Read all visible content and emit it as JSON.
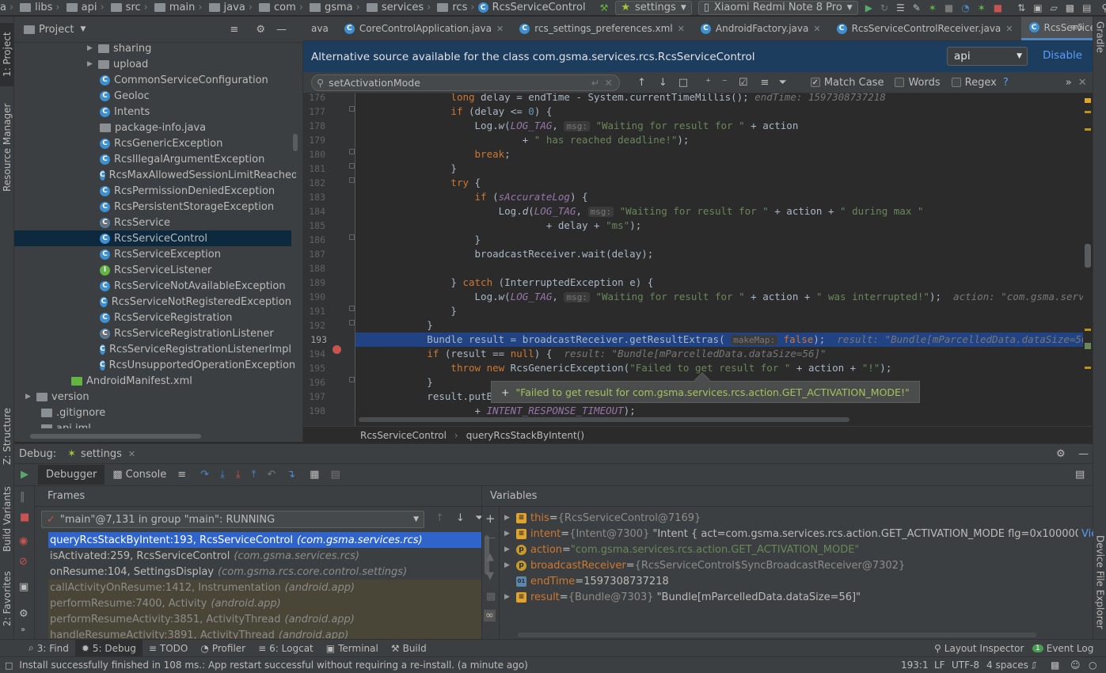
{
  "navbar": {
    "breadcrumbs": [
      "a",
      "libs",
      "api",
      "src",
      "main",
      "java",
      "com",
      "gsma",
      "services",
      "rcs"
    ],
    "current_class": "RcsServiceControl",
    "run_config": "settings",
    "device": "Xiaomi Redmi Note 8 Pro"
  },
  "left_tabs": {
    "project": "1: Project",
    "resource_manager": "Resource Manager",
    "structure": "Z: Structure",
    "build_variants": "Build Variants",
    "favorites": "2: Favorites"
  },
  "right_tabs": {
    "gradle": "Gradle",
    "device_file_explorer": "Device File Explorer"
  },
  "project": {
    "title": "Project",
    "tree": [
      {
        "label": "sharing",
        "kind": "folder",
        "expanded": false
      },
      {
        "label": "upload",
        "kind": "folder",
        "expanded": false
      },
      {
        "label": "CommonServiceConfiguration",
        "kind": "class"
      },
      {
        "label": "Geoloc",
        "kind": "class"
      },
      {
        "label": "Intents",
        "kind": "class"
      },
      {
        "label": "package-info.java",
        "kind": "file"
      },
      {
        "label": "RcsGenericException",
        "kind": "class"
      },
      {
        "label": "RcsIllegalArgumentException",
        "kind": "class"
      },
      {
        "label": "RcsMaxAllowedSessionLimitReached",
        "kind": "class"
      },
      {
        "label": "RcsPermissionDeniedException",
        "kind": "class"
      },
      {
        "label": "RcsPersistentStorageException",
        "kind": "class"
      },
      {
        "label": "RcsService",
        "kind": "abstract"
      },
      {
        "label": "RcsServiceControl",
        "kind": "class",
        "selected": true
      },
      {
        "label": "RcsServiceException",
        "kind": "class"
      },
      {
        "label": "RcsServiceListener",
        "kind": "interface"
      },
      {
        "label": "RcsServiceNotAvailableException",
        "kind": "class"
      },
      {
        "label": "RcsServiceNotRegisteredException",
        "kind": "class"
      },
      {
        "label": "RcsServiceRegistration",
        "kind": "class"
      },
      {
        "label": "RcsServiceRegistrationListener",
        "kind": "abstract"
      },
      {
        "label": "RcsServiceRegistrationListenerImpl",
        "kind": "class"
      },
      {
        "label": "RcsUnsupportedOperationException",
        "kind": "class"
      },
      {
        "label": "AndroidManifest.xml",
        "kind": "manifest"
      },
      {
        "label": "version",
        "kind": "folder",
        "expanded": false
      },
      {
        "label": ".gitignore",
        "kind": "file"
      },
      {
        "label": "api.iml",
        "kind": "file"
      }
    ]
  },
  "editor": {
    "tabs": [
      {
        "label": "ava",
        "active": false
      },
      {
        "label": "CoreControlApplication.java",
        "active": false
      },
      {
        "label": "rcs_settings_preferences.xml",
        "active": false
      },
      {
        "label": "AndroidFactory.java",
        "active": false
      },
      {
        "label": "RcsServiceControlReceiver.java",
        "active": false
      },
      {
        "label": "RcsServiceControl.java",
        "active": true
      }
    ],
    "tabs_overflow": "5",
    "alt_source_text": "Alternative source available for the class com.gsma.services.rcs.RcsServiceControl",
    "alt_source_select": "api",
    "alt_source_disable": "Disable",
    "find": {
      "query": "setActivationMode",
      "match_case_label": "Match Case",
      "match_case_checked": true,
      "words_label": "Words",
      "words_checked": false,
      "regex_label": "Regex",
      "regex_checked": false,
      "help": "?"
    },
    "line_numbers": [
      "176",
      "177",
      "178",
      "179",
      "180",
      "181",
      "182",
      "183",
      "184",
      "185",
      "186",
      "187",
      "188",
      "189",
      "190",
      "191",
      "192",
      "193",
      "194",
      "195",
      "196",
      "197",
      "198"
    ],
    "current_line": "193",
    "tooltip": "\"Failed to get result for com.gsma.services.rcs.action.GET_ACTIVATION_MODE!\"",
    "tooltip_prefix": "+",
    "breadcrumb_class": "RcsServiceControl",
    "breadcrumb_method": "queryRcsStackByIntent()"
  },
  "debug": {
    "title": "Debug:",
    "session": "settings",
    "tab_debugger": "Debugger",
    "tab_console": "Console",
    "frames_label": "Frames",
    "variables_label": "Variables",
    "thread": "\"main\"@7,131 in group \"main\": RUNNING",
    "frames": [
      {
        "method": "queryRcsStackByIntent:193, RcsServiceControl",
        "pkg": "(com.gsma.services.rcs)",
        "state": "selected"
      },
      {
        "method": "isActivated:259, RcsServiceControl",
        "pkg": "(com.gsma.services.rcs)",
        "state": "normal"
      },
      {
        "method": "onResume:104, SettingsDisplay",
        "pkg": "(com.gsma.rcs.core.control.settings)",
        "state": "normal"
      },
      {
        "method": "callActivityOnResume:1412, Instrumentation",
        "pkg": "(android.app)",
        "state": "library"
      },
      {
        "method": "performResume:7400, Activity",
        "pkg": "(android.app)",
        "state": "library"
      },
      {
        "method": "performResumeActivity:3851, ActivityThread",
        "pkg": "(android.app)",
        "state": "library"
      },
      {
        "method": "handleResumeActivity:3891, ActivityThread",
        "pkg": "(android.app)",
        "state": "library"
      }
    ],
    "variables": [
      {
        "name": "this",
        "type": "{RcsServiceControl@7169}",
        "value": "",
        "icon": "field",
        "expandable": true
      },
      {
        "name": "intent",
        "type": "{Intent@7300}",
        "value": "\"Intent { act=com.gsma.services.rcs.action.GET_ACTIVATION_MODE flg=0x1000001(",
        "icon": "field",
        "expandable": true,
        "link": "View"
      },
      {
        "name": "action",
        "type": "",
        "value": "\"com.gsma.services.rcs.action.GET_ACTIVATION_MODE\"",
        "icon": "param",
        "expandable": true
      },
      {
        "name": "broadcastReceiver",
        "type": "{RcsServiceControl$SyncBroadcastReceiver@7302}",
        "value": "",
        "icon": "param",
        "expandable": true
      },
      {
        "name": "endTime",
        "type": "",
        "value": "1597308737218",
        "icon": "long",
        "expandable": false
      },
      {
        "name": "result",
        "type": "{Bundle@7303}",
        "value": "\"Bundle[mParcelledData.dataSize=56]\"",
        "icon": "field",
        "expandable": true
      }
    ]
  },
  "tool_windows": [
    {
      "label": "3: Find",
      "active": false
    },
    {
      "label": "5: Debug",
      "active": true
    },
    {
      "label": "TODO",
      "active": false
    },
    {
      "label": "Profiler",
      "active": false
    },
    {
      "label": "6: Logcat",
      "active": false
    },
    {
      "label": "Terminal",
      "active": false
    },
    {
      "label": "Build",
      "active": false
    }
  ],
  "tool_windows_right": {
    "layout_inspector": "Layout Inspector",
    "event_log": "Event Log",
    "event_count": "1"
  },
  "status": {
    "message": "Install successfully finished in 108 ms.: App restart successful without requiring a re-install. (a minute ago)",
    "position": "193:1",
    "line_sep": "LF",
    "encoding": "UTF-8",
    "indent": "4 spaces"
  },
  "colors": {
    "accent": "#2f65ca",
    "alt_banner": "#1d3d5e",
    "current_line": "#214283"
  }
}
